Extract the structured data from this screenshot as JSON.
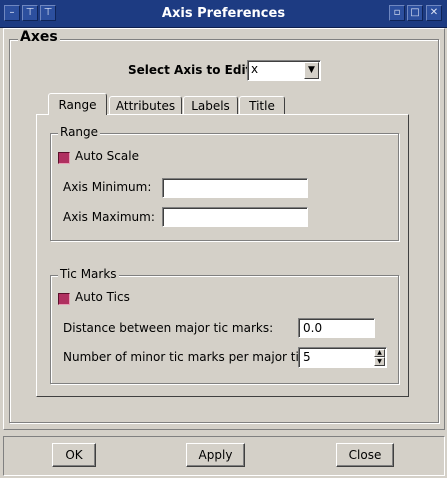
{
  "window": {
    "title": "Axis Preferences",
    "title_icons": [
      "minimize-dash-icon",
      "pin-icon",
      "pin-down-icon",
      "maximize-icon",
      "close-icon"
    ]
  },
  "axes_group": {
    "legend": "Axes",
    "select_label": "Select Axis to Edit:",
    "select_value": "x"
  },
  "tabs": [
    {
      "label": "Range",
      "active": true
    },
    {
      "label": "Attributes",
      "active": false
    },
    {
      "label": "Labels",
      "active": false
    },
    {
      "label": "Title",
      "active": false
    }
  ],
  "range_group": {
    "legend": "Range",
    "auto_scale_label": "Auto Scale",
    "auto_scale_checked": true,
    "axis_min_label": "Axis Minimum:",
    "axis_min_value": "",
    "axis_max_label": "Axis Maximum:",
    "axis_max_value": ""
  },
  "tic_group": {
    "legend": "Tic Marks",
    "auto_tics_label": "Auto Tics",
    "auto_tics_checked": true,
    "major_label": "Distance between major tic marks:",
    "major_value": "0.0",
    "minor_label": "Number of minor tic marks per major tic:",
    "minor_value": "5"
  },
  "buttons": {
    "ok": "OK",
    "apply": "Apply",
    "close": "Close"
  },
  "colors": {
    "titlebar": "#1d3b82",
    "window_bg": "#d4d0c8",
    "checkbox_on": "#b03060"
  }
}
